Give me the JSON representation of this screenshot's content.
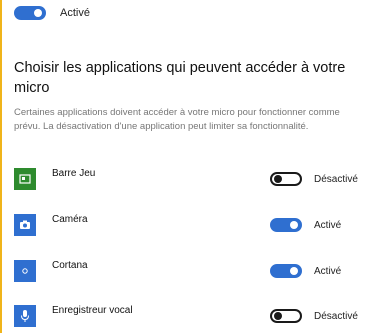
{
  "master": {
    "state": "on",
    "label": "Activé"
  },
  "section": {
    "heading": "Choisir les applications qui peuvent accéder à votre micro",
    "description": "Certaines applications doivent accéder à votre micro pour fonctionner comme prévu. La désactivation d'une application peut limiter sa fonctionnalité."
  },
  "apps": [
    {
      "name": "Barre Jeu",
      "icon": "xbox-game-bar-icon",
      "icon_bg": "#2e8b2e",
      "state": "off",
      "toggle_label": "Désactivé"
    },
    {
      "name": "Caméra",
      "icon": "camera-icon",
      "icon_bg": "#2f6fd0",
      "state": "on",
      "toggle_label": "Activé"
    },
    {
      "name": "Cortana",
      "icon": "cortana-icon",
      "icon_bg": "#2f6fd0",
      "state": "on",
      "toggle_label": "Activé"
    },
    {
      "name": "Enregistreur vocal",
      "icon": "microphone-icon",
      "icon_bg": "#2f6fd0",
      "state": "off",
      "toggle_label": "Désactivé"
    }
  ],
  "colors": {
    "accent": "#2f6fd0",
    "sidebar_accent": "#f0b41a"
  }
}
